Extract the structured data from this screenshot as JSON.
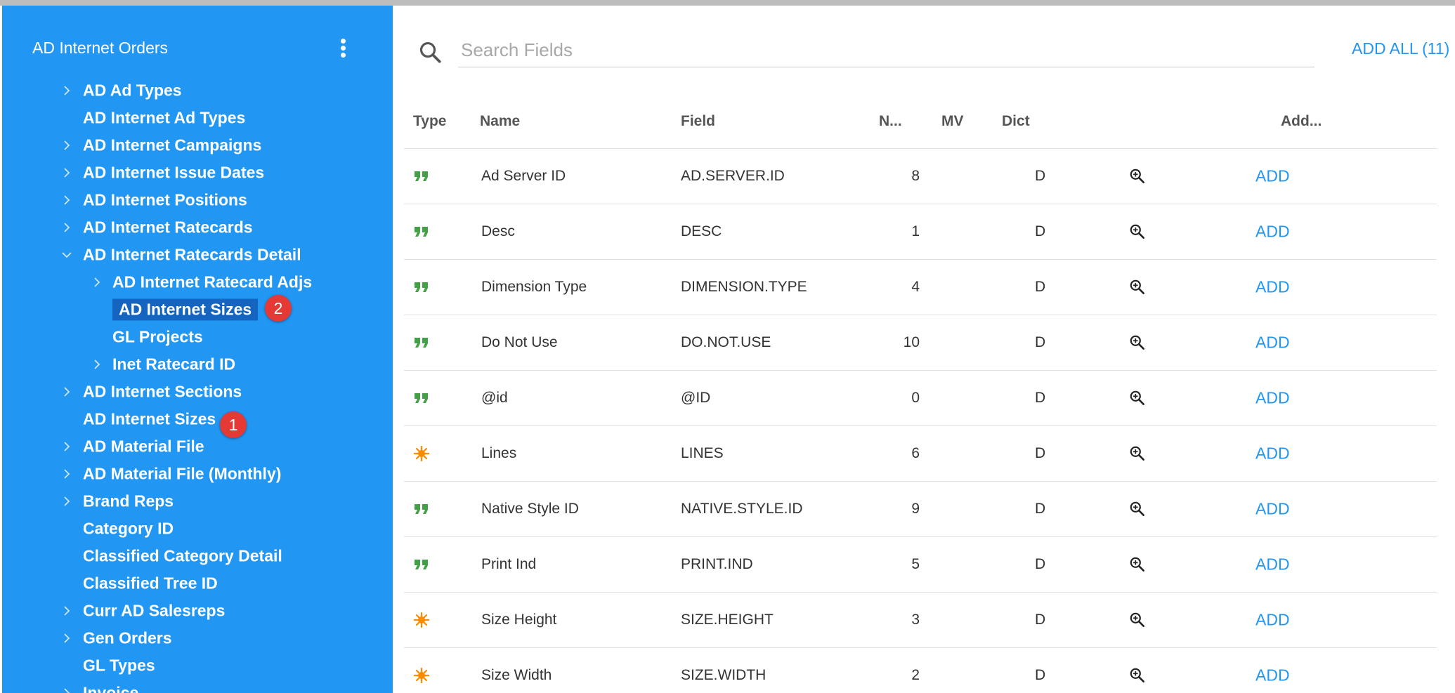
{
  "sidebar": {
    "title": "AD Internet Orders",
    "items": [
      {
        "label": "AD Ad Types",
        "chevron": "right"
      },
      {
        "label": "AD Internet Ad Types",
        "chevron": "none"
      },
      {
        "label": "AD Internet Campaigns",
        "chevron": "right"
      },
      {
        "label": "AD Internet Issue Dates",
        "chevron": "right"
      },
      {
        "label": "AD Internet Positions",
        "chevron": "right"
      },
      {
        "label": "AD Internet Ratecards",
        "chevron": "right"
      },
      {
        "label": "AD Internet Ratecards Detail",
        "chevron": "down"
      },
      {
        "label": "AD Internet Ratecard Adjs",
        "chevron": "right"
      },
      {
        "label": "AD Internet Sizes",
        "chevron": "none",
        "selected": true,
        "badge": "2"
      },
      {
        "label": "GL Projects",
        "chevron": "none"
      },
      {
        "label": "Inet Ratecard ID",
        "chevron": "right"
      },
      {
        "label": "AD Internet Sections",
        "chevron": "right"
      },
      {
        "label": "AD Internet Sizes",
        "chevron": "none",
        "badge": "1"
      },
      {
        "label": "AD Material File",
        "chevron": "right"
      },
      {
        "label": "AD Material File (Monthly)",
        "chevron": "right"
      },
      {
        "label": "Brand Reps",
        "chevron": "right"
      },
      {
        "label": "Category ID",
        "chevron": "none"
      },
      {
        "label": "Classified Category Detail",
        "chevron": "none"
      },
      {
        "label": "Classified Tree ID",
        "chevron": "none"
      },
      {
        "label": "Curr AD Salesreps",
        "chevron": "right"
      },
      {
        "label": "Gen Orders",
        "chevron": "right"
      },
      {
        "label": "GL Types",
        "chevron": "none"
      },
      {
        "label": "Invoice",
        "chevron": "right"
      }
    ]
  },
  "search": {
    "placeholder": "Search Fields",
    "value": ""
  },
  "add_all_label": "ADD ALL (11)",
  "table": {
    "headers": {
      "type": "Type",
      "name": "Name",
      "field": "Field",
      "n": "N...",
      "mv": "MV",
      "dict": "Dict",
      "add": "Add..."
    },
    "rows": [
      {
        "type_icon": "quote-icon",
        "name": "Ad Server ID",
        "field": "AD.SERVER.ID",
        "n": "8",
        "dict": "D",
        "add": "ADD"
      },
      {
        "type_icon": "quote-icon",
        "name": "Desc",
        "field": "DESC",
        "n": "1",
        "dict": "D",
        "add": "ADD"
      },
      {
        "type_icon": "quote-icon",
        "name": "Dimension Type",
        "field": "DIMENSION.TYPE",
        "n": "4",
        "dict": "D",
        "add": "ADD"
      },
      {
        "type_icon": "quote-icon",
        "name": "Do Not Use",
        "field": "DO.NOT.USE",
        "n": "10",
        "dict": "D",
        "add": "ADD"
      },
      {
        "type_icon": "quote-icon",
        "name": "@id",
        "field": "@ID",
        "n": "0",
        "dict": "D",
        "add": "ADD"
      },
      {
        "type_icon": "number-icon",
        "name": "Lines",
        "field": "LINES",
        "n": "6",
        "dict": "D",
        "add": "ADD"
      },
      {
        "type_icon": "quote-icon",
        "name": "Native Style ID",
        "field": "NATIVE.STYLE.ID",
        "n": "9",
        "dict": "D",
        "add": "ADD"
      },
      {
        "type_icon": "quote-icon",
        "name": "Print Ind",
        "field": "PRINT.IND",
        "n": "5",
        "dict": "D",
        "add": "ADD"
      },
      {
        "type_icon": "number-icon",
        "name": "Size Height",
        "field": "SIZE.HEIGHT",
        "n": "3",
        "dict": "D",
        "add": "ADD"
      },
      {
        "type_icon": "number-icon",
        "name": "Size Width",
        "field": "SIZE.WIDTH",
        "n": "2",
        "dict": "D",
        "add": "ADD"
      }
    ]
  },
  "colors": {
    "sidebar": "#2196f3",
    "selected": "#1565c0",
    "accent": "#2196f3",
    "badge": "#e53935",
    "quote_icon": "#43a047",
    "number_icon": "#fb8c00"
  }
}
